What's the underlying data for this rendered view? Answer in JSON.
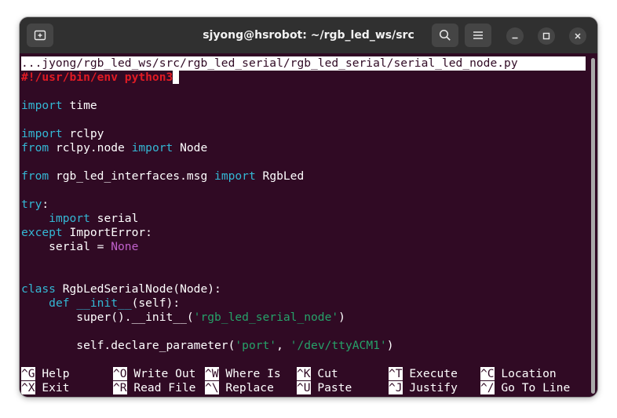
{
  "window": {
    "title": "sjyong@hsrobot: ~/rgb_led_ws/src",
    "icons": [
      "new-tab-icon",
      "search-icon",
      "hamburger-menu-icon",
      "minimize-icon",
      "maximize-icon",
      "close-icon"
    ]
  },
  "editor": {
    "file_path": "...jyong/rgb_led_ws/src/rgb_led_serial/rgb_led_serial/serial_led_node.py",
    "lines": {
      "l1": "#!/usr/bin/env python3",
      "l2_kw": "import",
      "l2_rest": " time",
      "l3_kw": "import",
      "l3_rest": " rclpy",
      "l4_kw": "from",
      "l4_mid": " rclpy.node ",
      "l4_kw2": "import",
      "l4_rest": " Node",
      "l5_kw": "from",
      "l5_mid": " rgb_led_interfaces.msg ",
      "l5_kw2": "import",
      "l5_rest": " RgbLed",
      "l6_kw": "try",
      "l6_rest": ":",
      "l7_indent": "    ",
      "l7_kw": "import",
      "l7_rest": " serial",
      "l8_kw": "except",
      "l8_rest": " ImportError:",
      "l9_text": "    serial = ",
      "l9_none": "None",
      "l10_kw": "class",
      "l10_rest": " RgbLedSerialNode(Node):",
      "l11_indent": "    ",
      "l11_kw": "def",
      "l11_space": " ",
      "l11_init": "__init__",
      "l11_rest": "(self):",
      "l12_text": "        super().__init__(",
      "l12_str": "'rgb_led_serial_node'",
      "l12_rest": ")",
      "l13_text": "        self.declare_parameter(",
      "l13_str1": "'port'",
      "l13_sep": ", ",
      "l13_str2": "'/dev/ttyACM1'",
      "l13_rest": ")"
    }
  },
  "shortcuts": [
    [
      {
        "key": "^G",
        "label": " Help"
      },
      {
        "key": "^X",
        "label": " Exit"
      }
    ],
    [
      {
        "key": "^O",
        "label": " Write Out"
      },
      {
        "key": "^R",
        "label": " Read File"
      }
    ],
    [
      {
        "key": "^W",
        "label": " Where Is"
      },
      {
        "key": "^\\",
        "label": " Replace"
      }
    ],
    [
      {
        "key": "^K",
        "label": " Cut"
      },
      {
        "key": "^U",
        "label": " Paste"
      }
    ],
    [
      {
        "key": "^T",
        "label": " Execute"
      },
      {
        "key": "^J",
        "label": " Justify"
      }
    ],
    [
      {
        "key": "^C",
        "label": " Location"
      },
      {
        "key": "^/",
        "label": " Go To Line"
      }
    ]
  ]
}
